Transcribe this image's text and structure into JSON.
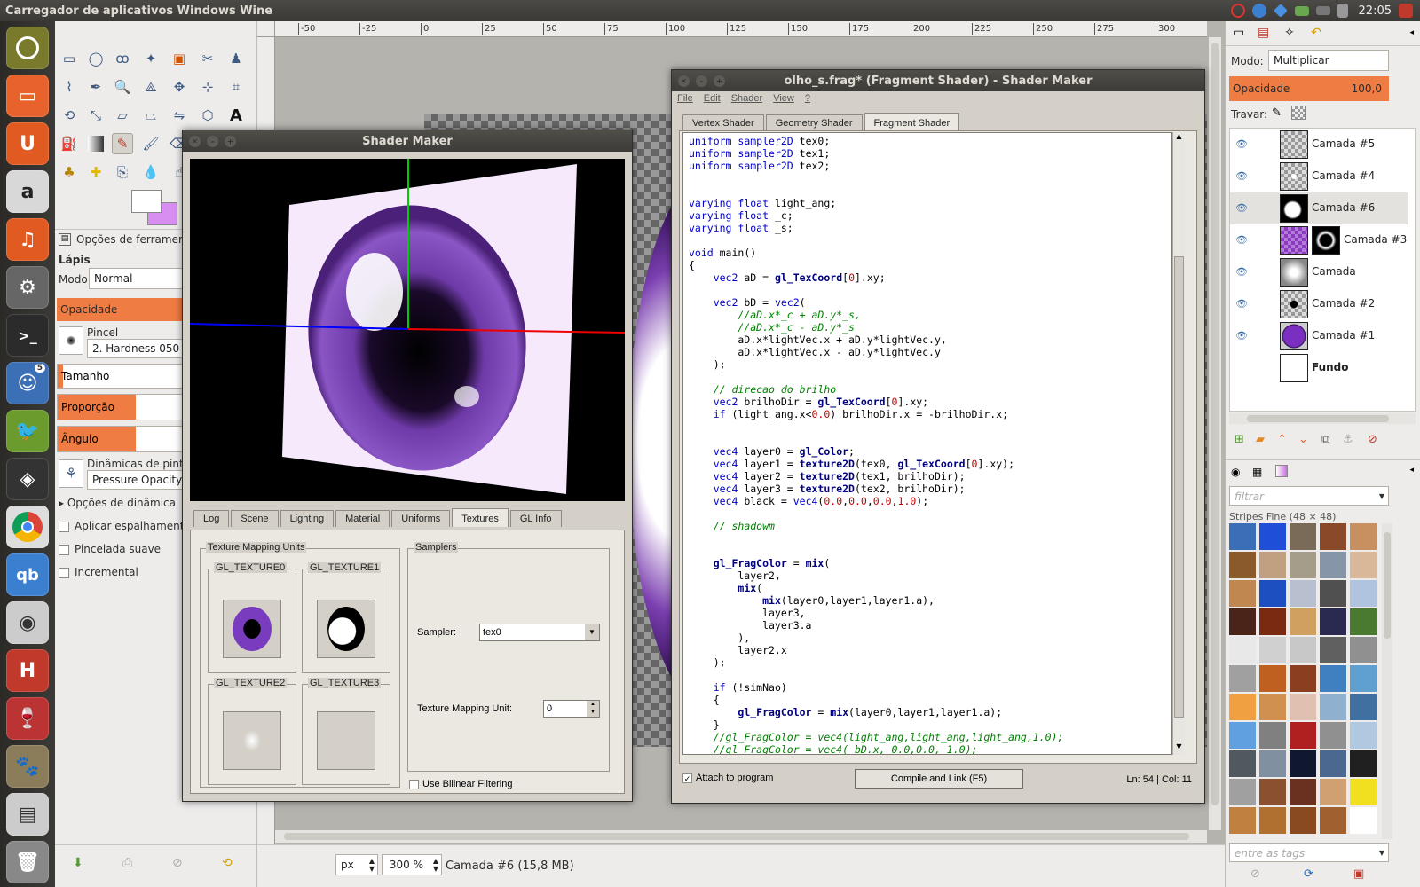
{
  "topbar": {
    "title": "Carregador de aplicativos Windows Wine",
    "clock": "22:05"
  },
  "launcher": {
    "badge": "5"
  },
  "toolbox": {
    "options_title": "Opções de ferramenta",
    "tool_name": "Lápis",
    "mode_label": "Modo:",
    "mode_value": "Normal",
    "opacity_label": "Opacidade",
    "brush_label": "Pincel",
    "brush_value": "2. Hardness 050",
    "size_label": "Tamanho",
    "ratio_label": "Proporção",
    "angle_label": "Ângulo",
    "dynamics_label": "Dinâmicas de pintura",
    "dynamics_value": "Pressure Opacity",
    "dynamics_options": "Opções de dinâmica",
    "jitter_label": "Aplicar espalhamento",
    "smooth_label": "Pincelada suave",
    "incremental_label": "Incremental"
  },
  "canvas": {
    "ruler_labels": [
      "-50",
      "-25",
      "0",
      "25",
      "50",
      "75",
      "100",
      "125",
      "150",
      "175",
      "200",
      "225",
      "250",
      "275",
      "300"
    ],
    "unit": "px",
    "zoom": "300 %",
    "status": "Camada #6 (15,8 MB)"
  },
  "shader_maker": {
    "title": "Shader Maker",
    "tabs": [
      "Log",
      "Scene",
      "Lighting",
      "Material",
      "Uniforms",
      "Textures",
      "GL Info"
    ],
    "active_tab": "Textures",
    "tmu_group": "Texture Mapping Units",
    "units": [
      "GL_TEXTURE0",
      "GL_TEXTURE1",
      "GL_TEXTURE2",
      "GL_TEXTURE3"
    ],
    "samplers_group": "Samplers",
    "sampler_label": "Sampler:",
    "sampler_value": "tex0",
    "tmu_label": "Texture Mapping Unit:",
    "tmu_value": "0",
    "bilinear_label": "Use Bilinear Filtering"
  },
  "editor": {
    "title": "olho_s.frag* (Fragment Shader) - Shader Maker",
    "menu": [
      "File",
      "Edit",
      "Shader",
      "View",
      "?"
    ],
    "tabs": [
      "Vertex Shader",
      "Geometry Shader",
      "Fragment Shader"
    ],
    "active_tab": "Fragment Shader",
    "attach_label": "Attach to program",
    "compile_label": "Compile and Link (F5)",
    "cursor": "Ln: 54 | Col: 11",
    "code": [
      "uniform sampler2D tex0;",
      "uniform sampler2D tex1;",
      "uniform sampler2D tex2;",
      "",
      "",
      "varying float light_ang;",
      "varying float _c;",
      "varying float _s;",
      "",
      "void main()",
      "{",
      "    vec2 aD = gl_TexCoord[0].xy;",
      "",
      "    vec2 bD = vec2(",
      "        //aD.x*_c + aD.y*_s,",
      "        //aD.x*_c - aD.y*_s",
      "        aD.x*lightVec.x + aD.y*lightVec.y,",
      "        aD.x*lightVec.x - aD.y*lightVec.y",
      "    );",
      "",
      "    // direcao do brilho",
      "    vec2 brilhoDir = gl_TexCoord[0].xy;",
      "    if (light_ang.x<0.0) brilhoDir.x = -brilhoDir.x;",
      "",
      "",
      "    vec4 layer0 = gl_Color;",
      "    vec4 layer1 = texture2D(tex0, gl_TexCoord[0].xy);",
      "    vec4 layer2 = texture2D(tex1, brilhoDir);",
      "    vec4 layer3 = texture2D(tex2, brilhoDir);",
      "    vec4 black = vec4(0.0,0.0,0.0,1.0);",
      "",
      "    // shadowm",
      "",
      "",
      "    gl_FragColor = mix(",
      "        layer2,",
      "        mix(",
      "            mix(layer0,layer1,layer1.a),",
      "            layer3,",
      "            layer3.a",
      "        ),",
      "        layer2.x",
      "    );",
      "",
      "    if (!simNao)",
      "    {",
      "        gl_FragColor = mix(layer0,layer1,layer1.a);",
      "    }",
      "    //gl_FragColor = vec4(light_ang,light_ang,light_ang,1.0);",
      "    //gl_FragColor = vec4( bD.x, 0.0,0.0, 1.0);"
    ]
  },
  "layers": {
    "mode_label": "Modo:",
    "mode_value": "Multiplicar",
    "opacity_label": "Opacidade",
    "opacity_value": "100,0",
    "lock_label": "Travar:",
    "items": [
      "Camada #5",
      "Camada #4",
      "Camada #6",
      "Camada #3",
      "Camada",
      "Camada #2",
      "Camada #1",
      "Fundo"
    ],
    "filter_placeholder": "filtrar",
    "pattern_name": "Stripes Fine (48 × 48)",
    "tags_placeholder": "entre as tags"
  }
}
